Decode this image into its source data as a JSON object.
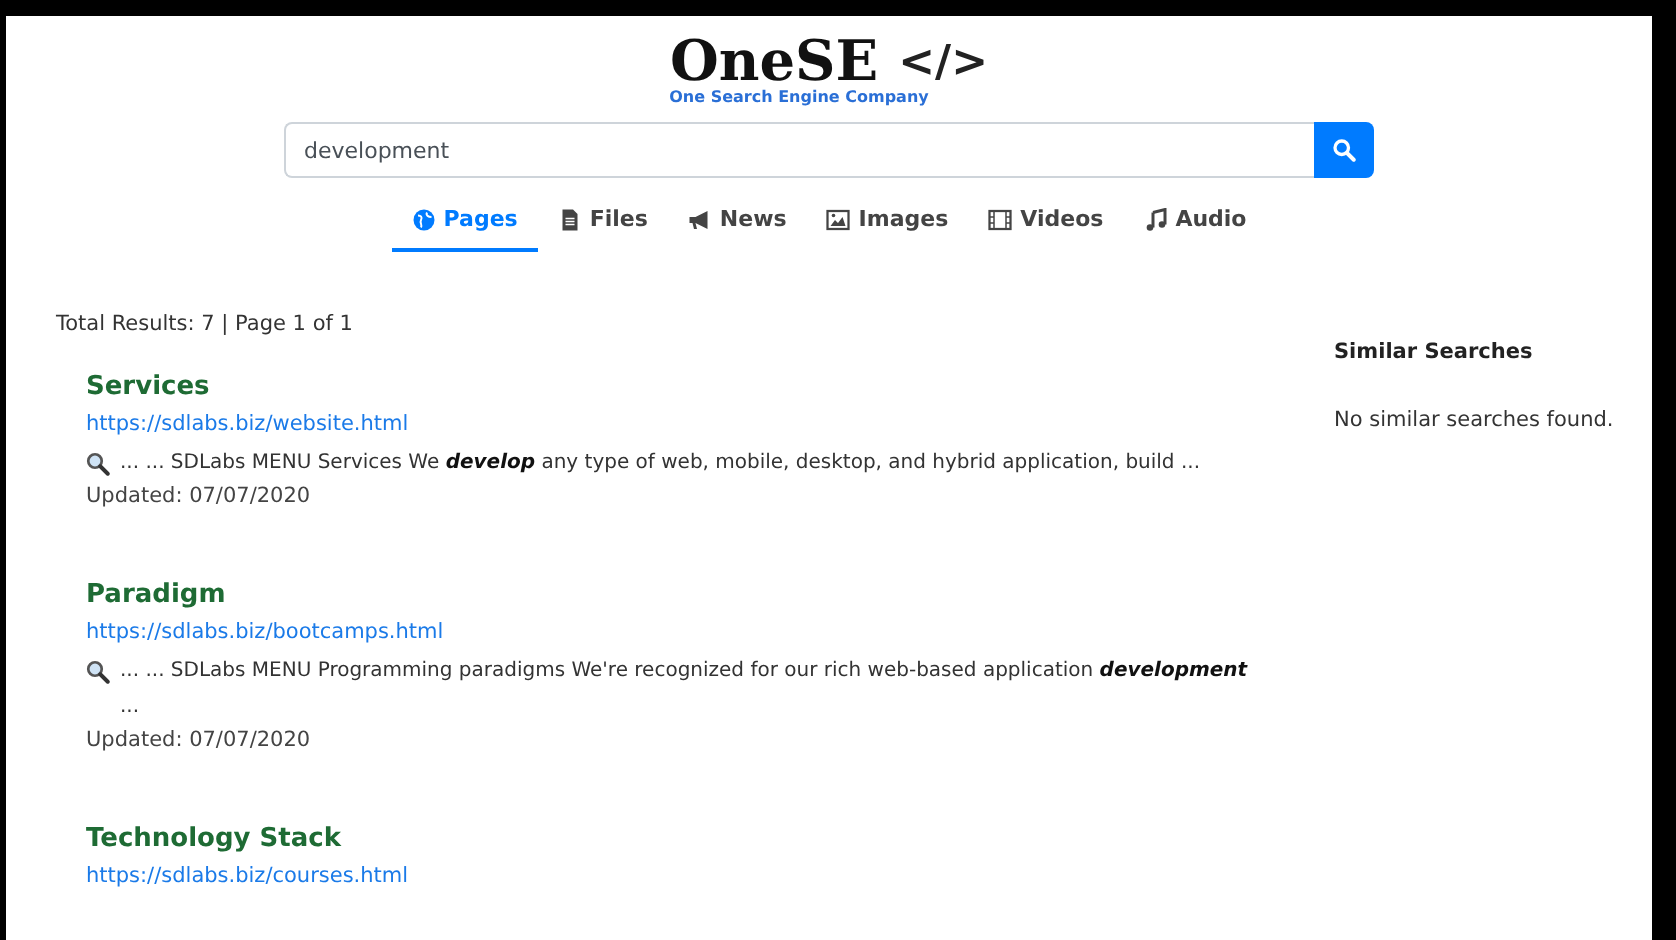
{
  "logo": {
    "name": "OneSE",
    "symbol": "</>",
    "tagline": "One Search Engine Company"
  },
  "search": {
    "value": "development"
  },
  "tabs": [
    {
      "label": "Pages",
      "selected": true
    },
    {
      "label": "Files",
      "selected": false
    },
    {
      "label": "News",
      "selected": false
    },
    {
      "label": "Images",
      "selected": false
    },
    {
      "label": "Videos",
      "selected": false
    },
    {
      "label": "Audio",
      "selected": false
    }
  ],
  "summary": "Total Results: 7 | Page 1 of 1",
  "results": [
    {
      "title": "Services",
      "url": "https://sdlabs.biz/website.html",
      "snippet": "... ... SDLabs MENU Services We **develop** any type of web, mobile, desktop, and hybrid application, build ...",
      "updated": "Updated: 07/07/2020"
    },
    {
      "title": "Paradigm",
      "url": "https://sdlabs.biz/bootcamps.html",
      "snippet": "... ... SDLabs MENU Programming paradigms We're recognized for our rich web-based application **development** ...",
      "updated": "Updated: 07/07/2020"
    },
    {
      "title": "Technology Stack",
      "url": "https://sdlabs.biz/courses.html"
    }
  ],
  "sidebar": {
    "title": "Similar Searches",
    "message": "No similar searches found."
  }
}
